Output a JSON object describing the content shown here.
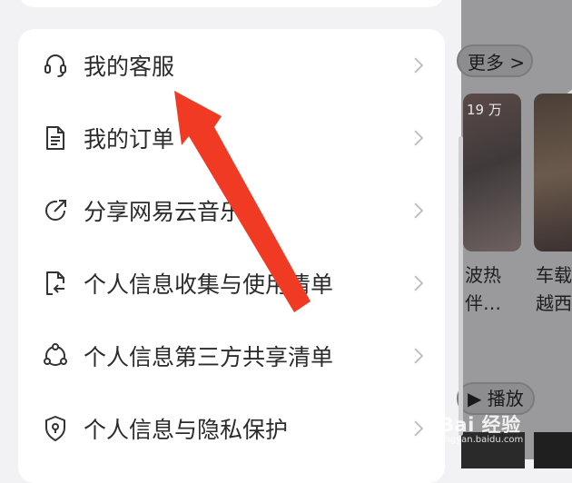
{
  "menu": {
    "items": [
      {
        "label": "我的客服",
        "icon": "headset-icon"
      },
      {
        "label": "我的订单",
        "icon": "document-icon"
      },
      {
        "label": "分享网易云音乐",
        "icon": "share-icon"
      },
      {
        "label": "个人信息收集与使用清单",
        "icon": "file-return-icon"
      },
      {
        "label": "个人信息第三方共享清单",
        "icon": "share-nodes-icon"
      },
      {
        "label": "个人信息与隐私保护",
        "icon": "shield-lock-icon"
      }
    ]
  },
  "background": {
    "more_label": "更多 >",
    "play_count": "19 万",
    "card1_line1": "波热",
    "card1_line2": "伴…",
    "card2_line1": "车载",
    "card2_line2": "越西",
    "play_label": "▶ 播放"
  },
  "watermark": {
    "main": "Bai 经验",
    "sub": "jingyan.baidu.com"
  },
  "colors": {
    "arrow": "#f03a23",
    "card": "#ffffff",
    "page_bg": "#f2f2f4"
  }
}
